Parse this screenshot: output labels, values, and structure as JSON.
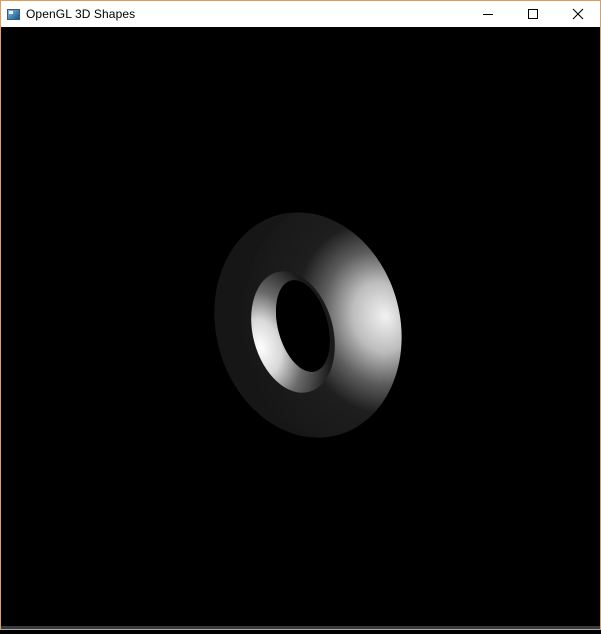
{
  "window": {
    "title": "OpenGL 3D Shapes",
    "icons": {
      "app": "app-window-icon",
      "minimize": "minimize-icon",
      "maximize": "maximize-icon",
      "close": "close-icon"
    }
  },
  "scene": {
    "background_color": "#000000",
    "shape": "torus",
    "shading": "grayscale-lit"
  }
}
